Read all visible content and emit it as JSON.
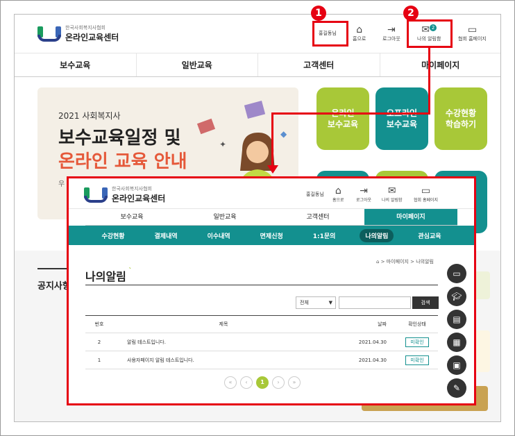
{
  "site": {
    "logo_sub": "한국사회복지사협회",
    "logo_main": "온라인교육센터",
    "user_label": "홍길동님",
    "header_links": [
      "홈으로",
      "로그아웃",
      "나의 알림함",
      "협회 홈페이지"
    ],
    "notification_count": "2",
    "nav": [
      "보수교육",
      "일반교육",
      "고객센터",
      "마이페이지"
    ]
  },
  "banner": {
    "year": "2021 사회복지사",
    "title_line1": "보수교육일정 및",
    "title_line2": "온라인 교육 안내",
    "left_text": "우"
  },
  "tiles": [
    {
      "label": "온라인\n보수교육"
    },
    {
      "label": "오프라인\n보수교육"
    },
    {
      "label": "수강현황\n학습하기"
    }
  ],
  "notice_title": "공지사항",
  "callouts": {
    "one": "1",
    "two": "2"
  },
  "overlay": {
    "nav": [
      "보수교육",
      "일반교육",
      "고객센터",
      "마이페이지"
    ],
    "subnav": [
      "수강현황",
      "결제내역",
      "이수내역",
      "면제신청",
      "1:1문의",
      "나의알림",
      "관심교육"
    ],
    "breadcrumb": "⌂ > 마이페이지 > 나의알림",
    "page_title": "나의알림",
    "filter_value": "전체",
    "search_button": "검색",
    "table": {
      "headers": [
        "번호",
        "제목",
        "날짜",
        "확인상태"
      ],
      "rows": [
        {
          "no": "2",
          "title": "알림 테스트입니다.",
          "date": "2021.04.30",
          "status": "미확인"
        },
        {
          "no": "1",
          "title": "사용자페이지 알림 테스트입니다.",
          "date": "2021.04.30",
          "status": "미확인"
        }
      ]
    },
    "pagination": {
      "first": "«",
      "prev": "‹",
      "current": "1",
      "next": "›",
      "last": "»"
    }
  },
  "colors": {
    "accent": "#13908f",
    "callout": "#e60012",
    "tile_green": "#a8c838",
    "tile_teal": "#13908f"
  }
}
